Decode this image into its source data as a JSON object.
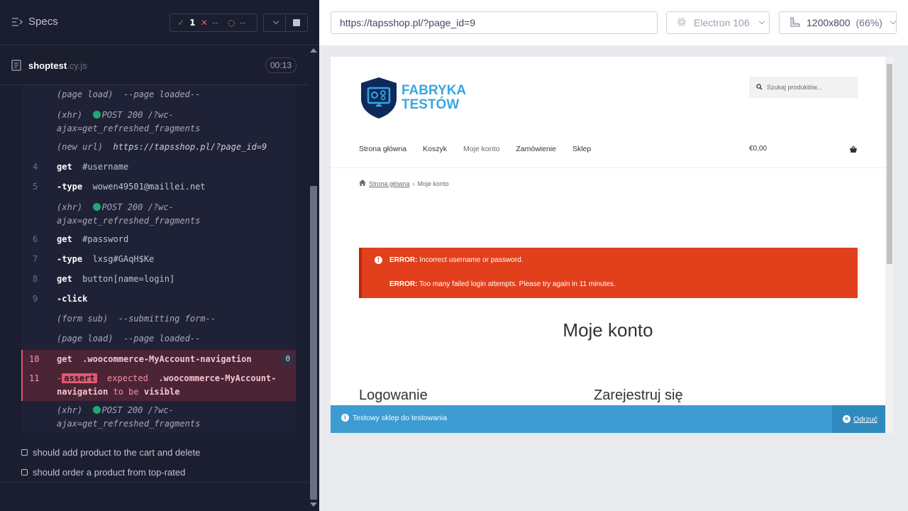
{
  "reporter": {
    "title": "Specs",
    "stats": {
      "passed": "1",
      "failed": "--",
      "pending": "--"
    },
    "spec": {
      "name": "shoptest",
      "ext": ".cy.js",
      "duration": "00:13"
    },
    "commands": [
      {
        "type": "event",
        "tag": "(page load)",
        "text": "--page loaded--"
      },
      {
        "type": "xhr",
        "tag": "(xhr)",
        "text1": "POST 200 /?wc-",
        "text2": "ajax=get_refreshed_fragments"
      },
      {
        "type": "event",
        "tag": "(new url)",
        "text": "https://tapsshop.pl/?page_id=9"
      },
      {
        "type": "cmd",
        "num": "4",
        "name": "get",
        "arg": "#username"
      },
      {
        "type": "cmd",
        "num": "5",
        "name": "-type",
        "arg": "wowen49501@maillei.net"
      },
      {
        "type": "xhr",
        "tag": "(xhr)",
        "text1": "POST 200 /?wc-",
        "text2": "ajax=get_refreshed_fragments"
      },
      {
        "type": "cmd",
        "num": "6",
        "name": "get",
        "arg": "#password"
      },
      {
        "type": "cmd",
        "num": "7",
        "name": "-type",
        "arg": "lxsg#GAqH$Ke"
      },
      {
        "type": "cmd",
        "num": "8",
        "name": "get",
        "arg": "button[name=login]"
      },
      {
        "type": "cmd",
        "num": "9",
        "name": "-click",
        "arg": ""
      },
      {
        "type": "event",
        "tag": "(form sub)",
        "text": "--submitting form--"
      },
      {
        "type": "event",
        "tag": "(page load)",
        "text": "--page loaded--"
      },
      {
        "type": "fail",
        "num": "10",
        "name": "get",
        "arg": ".woocommerce-MyAccount-navigation",
        "badge": "0"
      },
      {
        "type": "assert",
        "num": "11",
        "dash": "-",
        "tag": "assert",
        "expected": "expected",
        "sel1": ".woocommerce-MyAccount-",
        "sel2": "navigation",
        "to": "to be",
        "visible": "visible"
      },
      {
        "type": "xhr",
        "tag": "(xhr)",
        "text1": "POST 200 /?wc-",
        "text2": "ajax=get_refreshed_fragments"
      }
    ],
    "tests": [
      "should add product to the cart and delete",
      "should order a product from top-rated"
    ]
  },
  "topbar": {
    "url": "https://tapsshop.pl/?page_id=9",
    "browser": "Electron 106",
    "viewport": "1200x800",
    "zoom": "(66%)"
  },
  "site": {
    "logo_line1": "FABRYKA",
    "logo_line2": "TESTÓW",
    "search_placeholder": "Szukaj produktów...",
    "nav": [
      "Strona główna",
      "Koszyk",
      "Moje konto",
      "Zamówienie",
      "Sklep"
    ],
    "cart_total": "€0,00",
    "breadcrumb_home": "Strona główna",
    "breadcrumb_sep": "›",
    "breadcrumb_current": "Moje konto",
    "errors": [
      {
        "label": "ERROR:",
        "text": " Incorrect username or password."
      },
      {
        "label": "ERROR:",
        "text": " Too many failed login attempts. Please try again in 11 minutes."
      }
    ],
    "page_title": "Moje konto",
    "login_heading": "Logowanie",
    "register_heading": "Zarejestruj się",
    "notice_text": "Testowy sklep do testowania",
    "notice_dismiss": "Odrzuć"
  },
  "colors": {
    "reporter_bg": "#1b1e2e",
    "pass": "#1fa971",
    "fail": "#e45770",
    "error_bg": "#e2401c",
    "notice_bg": "#3d9cd2",
    "logo_blue": "#39a6e0"
  }
}
